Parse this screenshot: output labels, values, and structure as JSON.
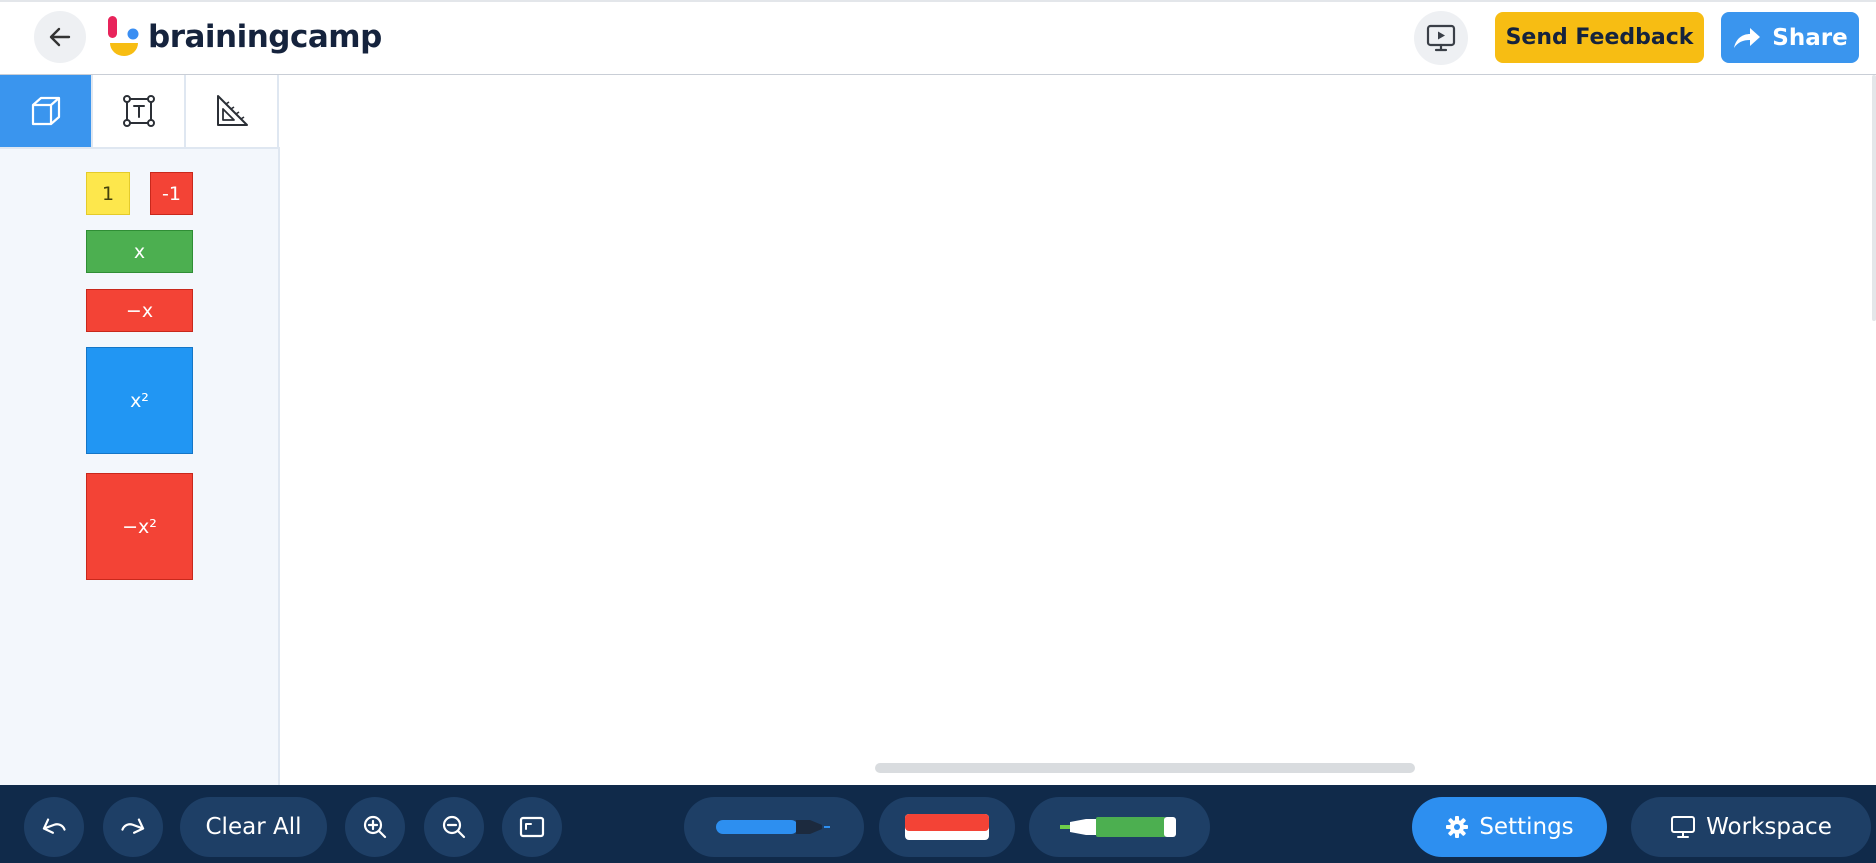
{
  "header": {
    "brand_name": "brainingcamp",
    "feedback_label": "Send Feedback",
    "share_label": "Share",
    "icons": {
      "back": "arrow-left-icon",
      "present": "present-screen-icon",
      "share": "share-arrow-icon"
    }
  },
  "sidebar": {
    "tabs": [
      {
        "name": "cube-tab",
        "icon": "cube-icon",
        "active": true
      },
      {
        "name": "text-box-tab",
        "icon": "text-box-icon",
        "active": false
      },
      {
        "name": "ruler-tab",
        "icon": "set-square-ruler-icon",
        "active": false
      }
    ],
    "tiles": {
      "one": "1",
      "neg_one": "-1",
      "x": "x",
      "neg_x": "−x",
      "x_squared": "x²",
      "neg_x_squared": "−x²"
    }
  },
  "toolbar": {
    "clear_all_label": "Clear All",
    "settings_label": "Settings",
    "workspace_label": "Workspace",
    "icons": {
      "undo": "undo-icon",
      "redo": "redo-icon",
      "zoom_in": "zoom-in-icon",
      "zoom_out": "zoom-out-icon",
      "fit": "fit-screen-icon",
      "marker": "marker-icon",
      "eraser": "eraser-icon",
      "highlighter": "highlighter-icon",
      "settings": "gear-icon",
      "workspace": "monitor-icon"
    }
  },
  "colors": {
    "accent_blue": "#3a95ee",
    "feedback_yellow": "#f7bd13",
    "bottom_bar": "#102a4a",
    "tile_yellow": "#fde74c",
    "tile_red": "#f34336",
    "tile_green": "#4caf50",
    "tile_blue": "#2196f3"
  }
}
